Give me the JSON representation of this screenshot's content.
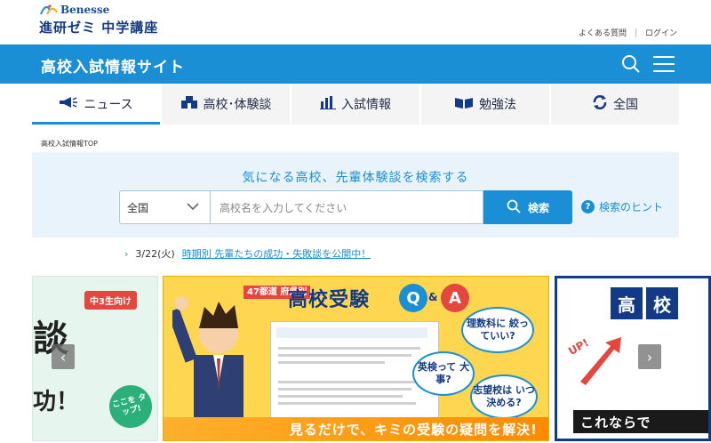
{
  "header": {
    "brand": "Benesse",
    "course": "進研ゼミ 中学講座",
    "links": [
      "よくある質問",
      "ログイン"
    ]
  },
  "band": {
    "site_title": "高校入試情報サイト",
    "icons": [
      "search-icon",
      "menu-icon"
    ]
  },
  "nav": {
    "tabs": [
      {
        "label": "ニュース",
        "icon": "megaphone-icon",
        "active": true
      },
      {
        "label": "高校･体験談",
        "icon": "school-icon",
        "active": false
      },
      {
        "label": "入試情報",
        "icon": "bar-chart-icon",
        "active": false
      },
      {
        "label": "勉強法",
        "icon": "book-icon",
        "active": false
      },
      {
        "label": "全国",
        "icon": "refresh-icon",
        "active": false
      }
    ]
  },
  "breadcrumb": "高校入試情報TOP",
  "search": {
    "heading": "気になる高校、先輩体験談を検索する",
    "region_value": "全国",
    "placeholder": "高校名を入力してください",
    "button_label": "検索",
    "hint_label": "検索のヒント"
  },
  "news": {
    "date": "3/22(火)",
    "link_text": "時期別 先輩たちの成功・失敗談を公開中！"
  },
  "carousel": {
    "left": {
      "badge": "中3生向け",
      "big_text": "談",
      "bottom_text": "功！",
      "tap": "ここを タップ!"
    },
    "main": {
      "tag": "47都道 府県別",
      "title": "高校受験",
      "q": "Q",
      "amp": "&",
      "a": "A",
      "bubbles": [
        "理数科に 絞っていい?",
        "英検って 大事?",
        "志望校は いつ決める?"
      ],
      "banner": "見るだけで、キミの受験の疑問を解決!"
    },
    "right": {
      "title_chars": [
        "高",
        "校"
      ],
      "up": "UP!",
      "bottom": "これならで"
    },
    "prev": "‹",
    "next": "›"
  },
  "colors": {
    "brand_blue": "#1a8fd6",
    "navy": "#123a86",
    "accent_red": "#e5473e",
    "banner_yellow": "#ffd64f"
  }
}
